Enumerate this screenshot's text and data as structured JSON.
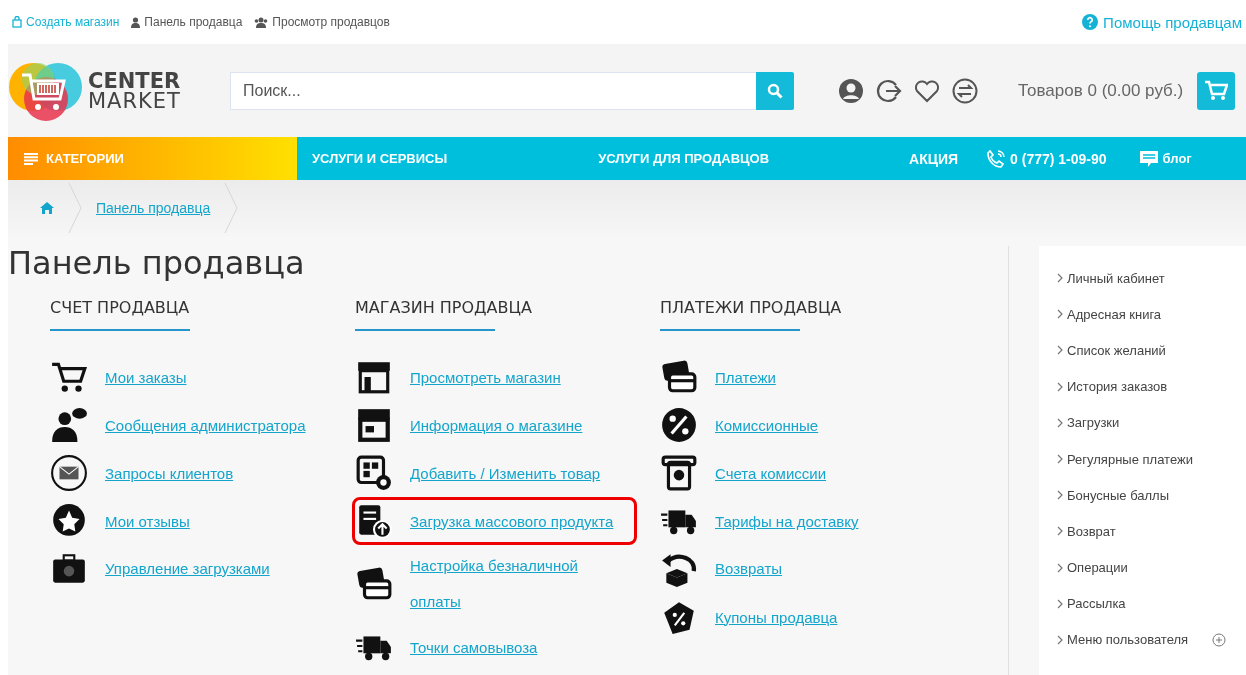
{
  "top_bar": {
    "links": [
      {
        "label": "Создать магазин",
        "kind": "accent"
      },
      {
        "label": "Панель продавца",
        "kind": "plain"
      },
      {
        "label": "Просмотр продавцов",
        "kind": "plain"
      }
    ],
    "help": "Помощь продавцам"
  },
  "header": {
    "logo_top": "CENTER",
    "logo_bottom": "MARKET",
    "search": {
      "placeholder": "Поиск..."
    },
    "cart_summary": "Товаров 0 (0.00 руб.)"
  },
  "nav": {
    "categories": "КАТЕГОРИИ",
    "items": [
      "УСЛУГИ И СЕРВИСЫ",
      "УСЛУГИ ДЛЯ ПРОДАВЦОВ",
      "АКЦИЯ"
    ],
    "phone": "0 (777) 1-09-90",
    "blog": "блог"
  },
  "breadcrumb": [
    "Панель продавца"
  ],
  "page_title": "Панель продавца",
  "sections": [
    {
      "title": "СЧЕТ ПРОДАВЦА",
      "links": [
        {
          "label": "Мои заказы",
          "highlighted": false
        },
        {
          "label": "Сообщения администратора",
          "highlighted": false
        },
        {
          "label": "Запросы клиентов",
          "highlighted": false
        },
        {
          "label": "Мои отзывы",
          "highlighted": false
        },
        {
          "label": "Управление загрузками",
          "highlighted": false
        }
      ]
    },
    {
      "title": "МАГАЗИН ПРОДАВЦА",
      "links": [
        {
          "label": "Просмотреть магазин",
          "highlighted": false
        },
        {
          "label": "Информация о магазине",
          "highlighted": false
        },
        {
          "label": "Добавить / Изменить товар",
          "highlighted": false
        },
        {
          "label": "Загрузка массового продукта",
          "highlighted": true
        },
        {
          "label": "Настройка безналичной оплаты",
          "highlighted": false
        },
        {
          "label": "Точки самовывоза",
          "highlighted": false
        }
      ]
    },
    {
      "title": "ПЛАТЕЖИ ПРОДАВЦА",
      "links": [
        {
          "label": "Платежи",
          "highlighted": false
        },
        {
          "label": "Комиссионные",
          "highlighted": false
        },
        {
          "label": "Счета комиссии",
          "highlighted": false
        },
        {
          "label": "Тарифы на доставку",
          "highlighted": false
        },
        {
          "label": "Возвраты",
          "highlighted": false
        },
        {
          "label": "Купоны продавца",
          "highlighted": false
        }
      ]
    }
  ],
  "account_menu": [
    "Личный кабинет",
    "Адресная книга",
    "Список желаний",
    "История заказов",
    "Загрузки",
    "Регулярные платежи",
    "Бонусные баллы",
    "Возврат",
    "Операции",
    "Рассылка",
    "Меню пользователя"
  ]
}
